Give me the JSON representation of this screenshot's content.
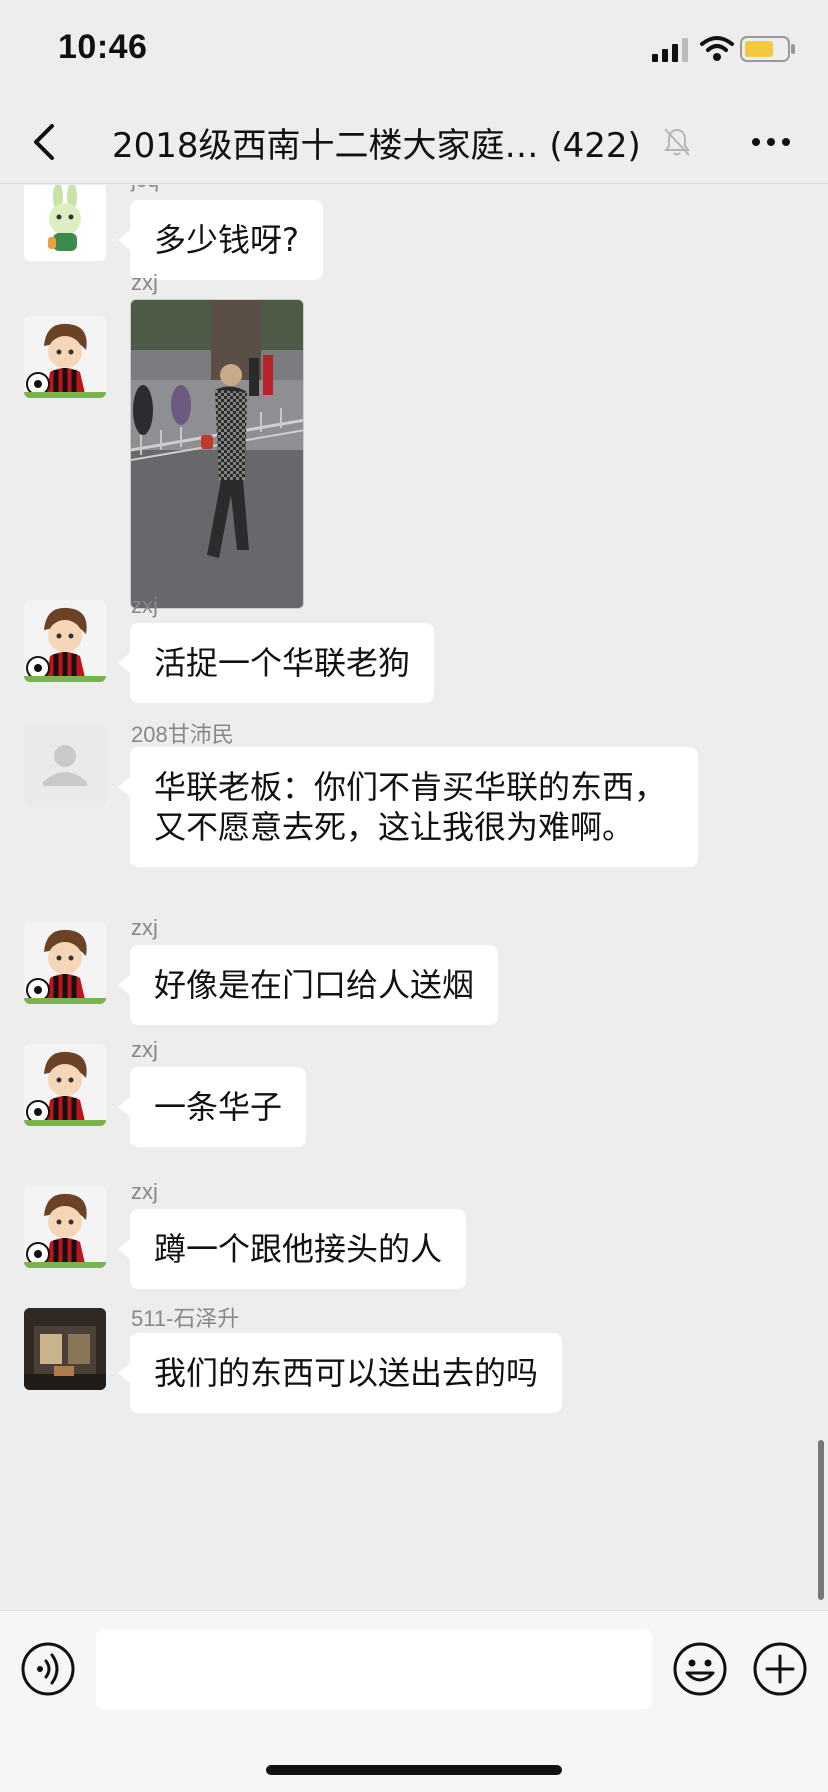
{
  "status_bar": {
    "time": "10:46",
    "icons": [
      "signal-icon",
      "wifi-icon",
      "battery-icon"
    ]
  },
  "nav": {
    "title": "2018级西南十二楼大家庭… (422)",
    "icons": [
      "back-icon",
      "muted-icon",
      "more-icon"
    ]
  },
  "messages": [
    {
      "sender": "jcq",
      "text": "多少钱呀?"
    },
    {
      "sender": "zxj",
      "type": "image"
    },
    {
      "sender": "zxj",
      "text": "活捉一个华联老狗"
    },
    {
      "sender": "208甘沛民",
      "text": "华联老板：你们不肯买华联的东西，又不愿意去死，这让我很为难啊。"
    },
    {
      "sender": "zxj",
      "text": "好像是在门口给人送烟"
    },
    {
      "sender": "zxj",
      "text": "一条华子"
    },
    {
      "sender": "zxj",
      "text": "蹲一个跟他接头的人"
    },
    {
      "sender": "511-石泽升",
      "text": "我们的东西可以送出去的吗"
    }
  ],
  "input_bar": {
    "message_value": "",
    "icons": [
      "voice-icon",
      "emoji-icon",
      "plus-icon"
    ]
  },
  "colors": {
    "background": "#ededed",
    "bubble": "#ffffff",
    "sender": "#888888",
    "battery": "#f5c842"
  }
}
